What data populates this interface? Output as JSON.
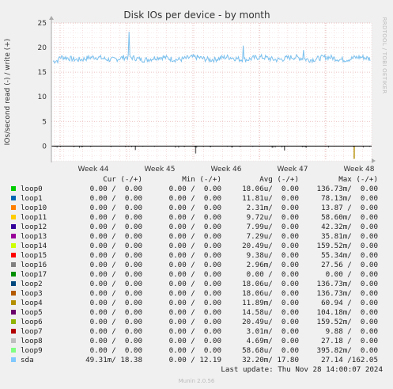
{
  "chart_data": {
    "type": "line",
    "title": "Disk IOs per device - by month",
    "ylabel": "IOs/second read (-) / write (+)",
    "side_label": "RRDTOOL / TOBI OETIKER",
    "ylim": [
      -3,
      25
    ],
    "y_ticks": [
      "25",
      "20",
      "15",
      "10",
      "5",
      "0"
    ],
    "y_tick_values": [
      25,
      20,
      15,
      10,
      5,
      0
    ],
    "x_ticks": [
      "Week 44",
      "Week 45",
      "Week 46",
      "Week 47",
      "Week 48"
    ],
    "series": [
      {
        "name": "sda",
        "color": "#7cc1ee",
        "write_level": 17.8,
        "write_spikes": [
          [
            0.24,
            23.2
          ],
          [
            0.6,
            20.4
          ],
          [
            0.79,
            19.5
          ]
        ],
        "read_spikes": [
          [
            0.26,
            -0.8
          ],
          [
            0.45,
            -1.5
          ],
          [
            0.73,
            -0.9
          ],
          [
            0.95,
            -2.6
          ]
        ]
      }
    ]
  },
  "legend": {
    "headers": {
      "cur": "Cur (-/+)",
      "min": "Min (-/+)",
      "avg": "Avg (-/+)",
      "max": "Max (-/+)"
    },
    "rows": [
      {
        "name": "loop0",
        "color": "#00cc00",
        "cur": "0.00 /  0.00",
        "min": "0.00 /  0.00",
        "avg": "18.06u/  0.00",
        "max": "136.73m/  0.00"
      },
      {
        "name": "loop1",
        "color": "#0066b3",
        "cur": "0.00 /  0.00",
        "min": "0.00 /  0.00",
        "avg": "11.81u/  0.00",
        "max": "78.13m/  0.00"
      },
      {
        "name": "loop10",
        "color": "#ff8000",
        "cur": "0.00 /  0.00",
        "min": "0.00 /  0.00",
        "avg": "2.31m/  0.00",
        "max": "13.87 /  0.00"
      },
      {
        "name": "loop11",
        "color": "#ffcc00",
        "cur": "0.00 /  0.00",
        "min": "0.00 /  0.00",
        "avg": "9.72u/  0.00",
        "max": "58.60m/  0.00"
      },
      {
        "name": "loop12",
        "color": "#330099",
        "cur": "0.00 /  0.00",
        "min": "0.00 /  0.00",
        "avg": "7.99u/  0.00",
        "max": "42.32m/  0.00"
      },
      {
        "name": "loop13",
        "color": "#990099",
        "cur": "0.00 /  0.00",
        "min": "0.00 /  0.00",
        "avg": "7.29u/  0.00",
        "max": "35.81m/  0.00"
      },
      {
        "name": "loop14",
        "color": "#ccff00",
        "cur": "0.00 /  0.00",
        "min": "0.00 /  0.00",
        "avg": "20.49u/  0.00",
        "max": "159.52m/  0.00"
      },
      {
        "name": "loop15",
        "color": "#ff0000",
        "cur": "0.00 /  0.00",
        "min": "0.00 /  0.00",
        "avg": "9.38u/  0.00",
        "max": "55.34m/  0.00"
      },
      {
        "name": "loop16",
        "color": "#808080",
        "cur": "0.00 /  0.00",
        "min": "0.00 /  0.00",
        "avg": "2.96m/  0.00",
        "max": "27.56 /  0.00"
      },
      {
        "name": "loop17",
        "color": "#008f00",
        "cur": "0.00 /  0.00",
        "min": "0.00 /  0.00",
        "avg": "0.00 /  0.00",
        "max": "0.00 /  0.00"
      },
      {
        "name": "loop2",
        "color": "#00487d",
        "cur": "0.00 /  0.00",
        "min": "0.00 /  0.00",
        "avg": "18.06u/  0.00",
        "max": "136.73m/  0.00"
      },
      {
        "name": "loop3",
        "color": "#b35a00",
        "cur": "0.00 /  0.00",
        "min": "0.00 /  0.00",
        "avg": "18.06u/  0.00",
        "max": "136.73m/  0.00"
      },
      {
        "name": "loop4",
        "color": "#b38f00",
        "cur": "0.00 /  0.00",
        "min": "0.00 /  0.00",
        "avg": "11.89m/  0.00",
        "max": "60.94 /  0.00"
      },
      {
        "name": "loop5",
        "color": "#6b006b",
        "cur": "0.00 /  0.00",
        "min": "0.00 /  0.00",
        "avg": "14.58u/  0.00",
        "max": "104.18m/  0.00"
      },
      {
        "name": "loop6",
        "color": "#8fb300",
        "cur": "0.00 /  0.00",
        "min": "0.00 /  0.00",
        "avg": "20.49u/  0.00",
        "max": "159.52m/  0.00"
      },
      {
        "name": "loop7",
        "color": "#b30000",
        "cur": "0.00 /  0.00",
        "min": "0.00 /  0.00",
        "avg": "3.01m/  0.00",
        "max": "9.88 /  0.00"
      },
      {
        "name": "loop8",
        "color": "#bebebe",
        "cur": "0.00 /  0.00",
        "min": "0.00 /  0.00",
        "avg": "4.69m/  0.00",
        "max": "27.18 /  0.00"
      },
      {
        "name": "loop9",
        "color": "#80ff80",
        "cur": "0.00 /  0.00",
        "min": "0.00 /  0.00",
        "avg": "58.68u/  0.00",
        "max": "395.82m/  0.00"
      },
      {
        "name": "sda",
        "color": "#80c9ff",
        "cur": "49.31m/ 18.38",
        "min": "0.00 / 12.19",
        "avg": "32.20m/ 17.80",
        "max": "27.14 /162.05"
      }
    ]
  },
  "footer": {
    "last_update": "Last update: Thu Nov 28 14:00:07 2024",
    "version": "Munin 2.0.56"
  }
}
